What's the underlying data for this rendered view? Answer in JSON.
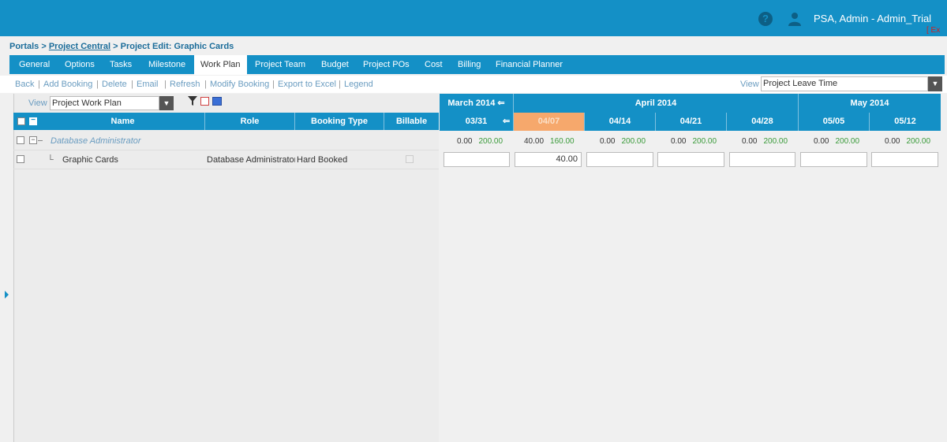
{
  "header": {
    "help_glyph": "?",
    "user_name": "PSA, Admin - Admin_Trial",
    "exit_text": "[ Ex"
  },
  "breadcrumb": {
    "portals": "Portals",
    "sep1": " > ",
    "project_central": "Project Central",
    "sep2": " > ",
    "current": "Project Edit: Graphic Cards"
  },
  "tabs": [
    {
      "label": "General"
    },
    {
      "label": "Options"
    },
    {
      "label": "Tasks"
    },
    {
      "label": "Milestone"
    },
    {
      "label": "Work Plan",
      "active": true
    },
    {
      "label": "Project Team"
    },
    {
      "label": "Budget"
    },
    {
      "label": "Project POs"
    },
    {
      "label": "Cost"
    },
    {
      "label": "Billing"
    },
    {
      "label": "Financial Planner"
    }
  ],
  "actions": [
    "Back",
    "Add Booking",
    "Delete",
    "Email",
    "Refresh",
    "Modify Booking",
    "Export to Excel",
    "Legend"
  ],
  "action_separator": "|",
  "view_right": {
    "label": "View",
    "value": "Project Leave Time"
  },
  "view_left": {
    "label": "View",
    "value": "Project Work Plan"
  },
  "grid": {
    "columns": {
      "name": "Name",
      "role": "Role",
      "booking_type": "Booking Type",
      "billable": "Billable"
    },
    "rows": [
      {
        "name": "Database Administrator",
        "role": "",
        "booking_type": "",
        "expander": "−"
      },
      {
        "name": "Graphic Cards",
        "role": "Database Administrator",
        "booking_type": "Hard Booked"
      }
    ]
  },
  "timeline": {
    "months": [
      {
        "label": "March 2014",
        "arrow": "⇐"
      },
      {
        "label": "April 2014"
      },
      {
        "label": "May 2014"
      }
    ],
    "weeks": [
      "03/31",
      "04/07",
      "04/14",
      "04/21",
      "04/28",
      "05/05",
      "05/12"
    ],
    "current_week_index": 1,
    "week_arrow": "⇐",
    "summary": [
      {
        "booked": "0.00",
        "available": "200.00"
      },
      {
        "booked": "40.00",
        "available": "160.00"
      },
      {
        "booked": "0.00",
        "available": "200.00"
      },
      {
        "booked": "0.00",
        "available": "200.00"
      },
      {
        "booked": "0.00",
        "available": "200.00"
      },
      {
        "booked": "0.00",
        "available": "200.00"
      },
      {
        "booked": "0.00",
        "available": "200.00"
      }
    ],
    "inputs": [
      "",
      "40.00",
      "",
      "",
      "",
      "",
      ""
    ]
  },
  "colors": {
    "primary": "#1490c6",
    "current_week": "#f6a86c",
    "available": "#3a9a3a",
    "link": "#6a9cc0"
  }
}
